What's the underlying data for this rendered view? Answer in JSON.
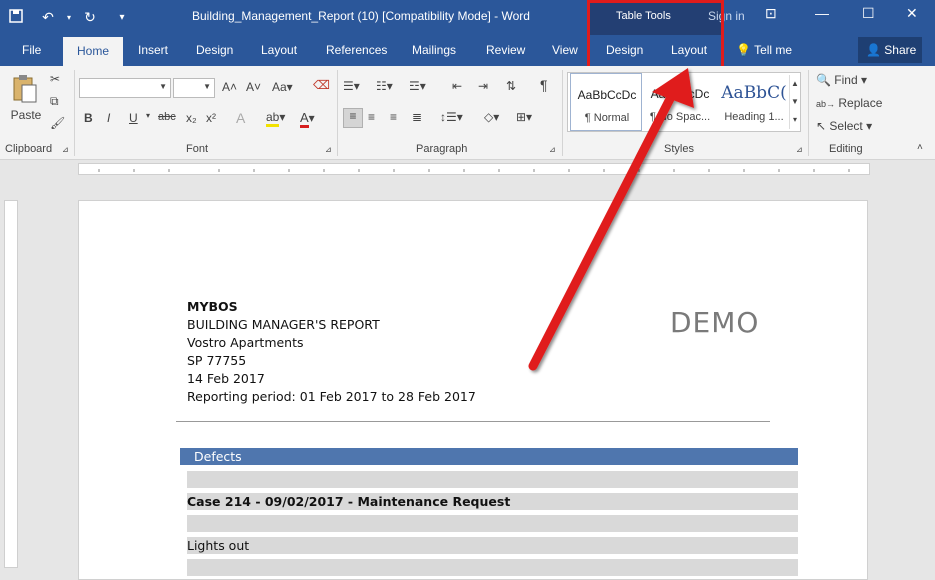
{
  "titlebar": {
    "title": "Building_Management_Report (10) [Compatibility Mode] - Word",
    "context_group": "Table Tools",
    "signin": "Sign in"
  },
  "tabs": {
    "file": "File",
    "home": "Home",
    "insert": "Insert",
    "design": "Design",
    "layout": "Layout",
    "references": "References",
    "mailings": "Mailings",
    "review": "Review",
    "view": "View",
    "ctx_design": "Design",
    "ctx_layout": "Layout",
    "tellme": "Tell me",
    "share": "Share"
  },
  "ribbon": {
    "clipboard": {
      "paste": "Paste",
      "label": "Clipboard"
    },
    "font": {
      "label": "Font",
      "bold": "B",
      "italic": "I",
      "underline": "U",
      "strike": "abc",
      "sub": "x₂",
      "sup": "x²"
    },
    "paragraph": {
      "label": "Paragraph",
      "pilcrow": "¶"
    },
    "styles": {
      "label": "Styles",
      "items": [
        {
          "preview": "AaBbCcDc",
          "name": "¶ Normal"
        },
        {
          "preview": "AaBbCcDc",
          "name": "¶ No Spac..."
        },
        {
          "preview": "AaBbC(",
          "name": "Heading 1..."
        }
      ]
    },
    "editing": {
      "label": "Editing",
      "find": "Find",
      "replace": "Replace",
      "select": "Select"
    }
  },
  "document": {
    "org": "MYBOS",
    "report_title": "BUILDING MANAGER'S REPORT",
    "building": "Vostro Apartments",
    "sp": "SP 77755",
    "date": "14 Feb 2017",
    "period": "Reporting period: 01 Feb 2017 to 28 Feb 2017",
    "logo": "DEMO",
    "section": "Defects",
    "case_title": "Case 214 - 09/02/2017 - Maintenance Request",
    "case_detail": "Lights out"
  },
  "colors": {
    "word_blue": "#2b579a",
    "context_blue": "#233f73",
    "highlight_red": "#e01c1c",
    "defects_bar": "#4f76ae",
    "row_gray": "#d9d9d9"
  }
}
